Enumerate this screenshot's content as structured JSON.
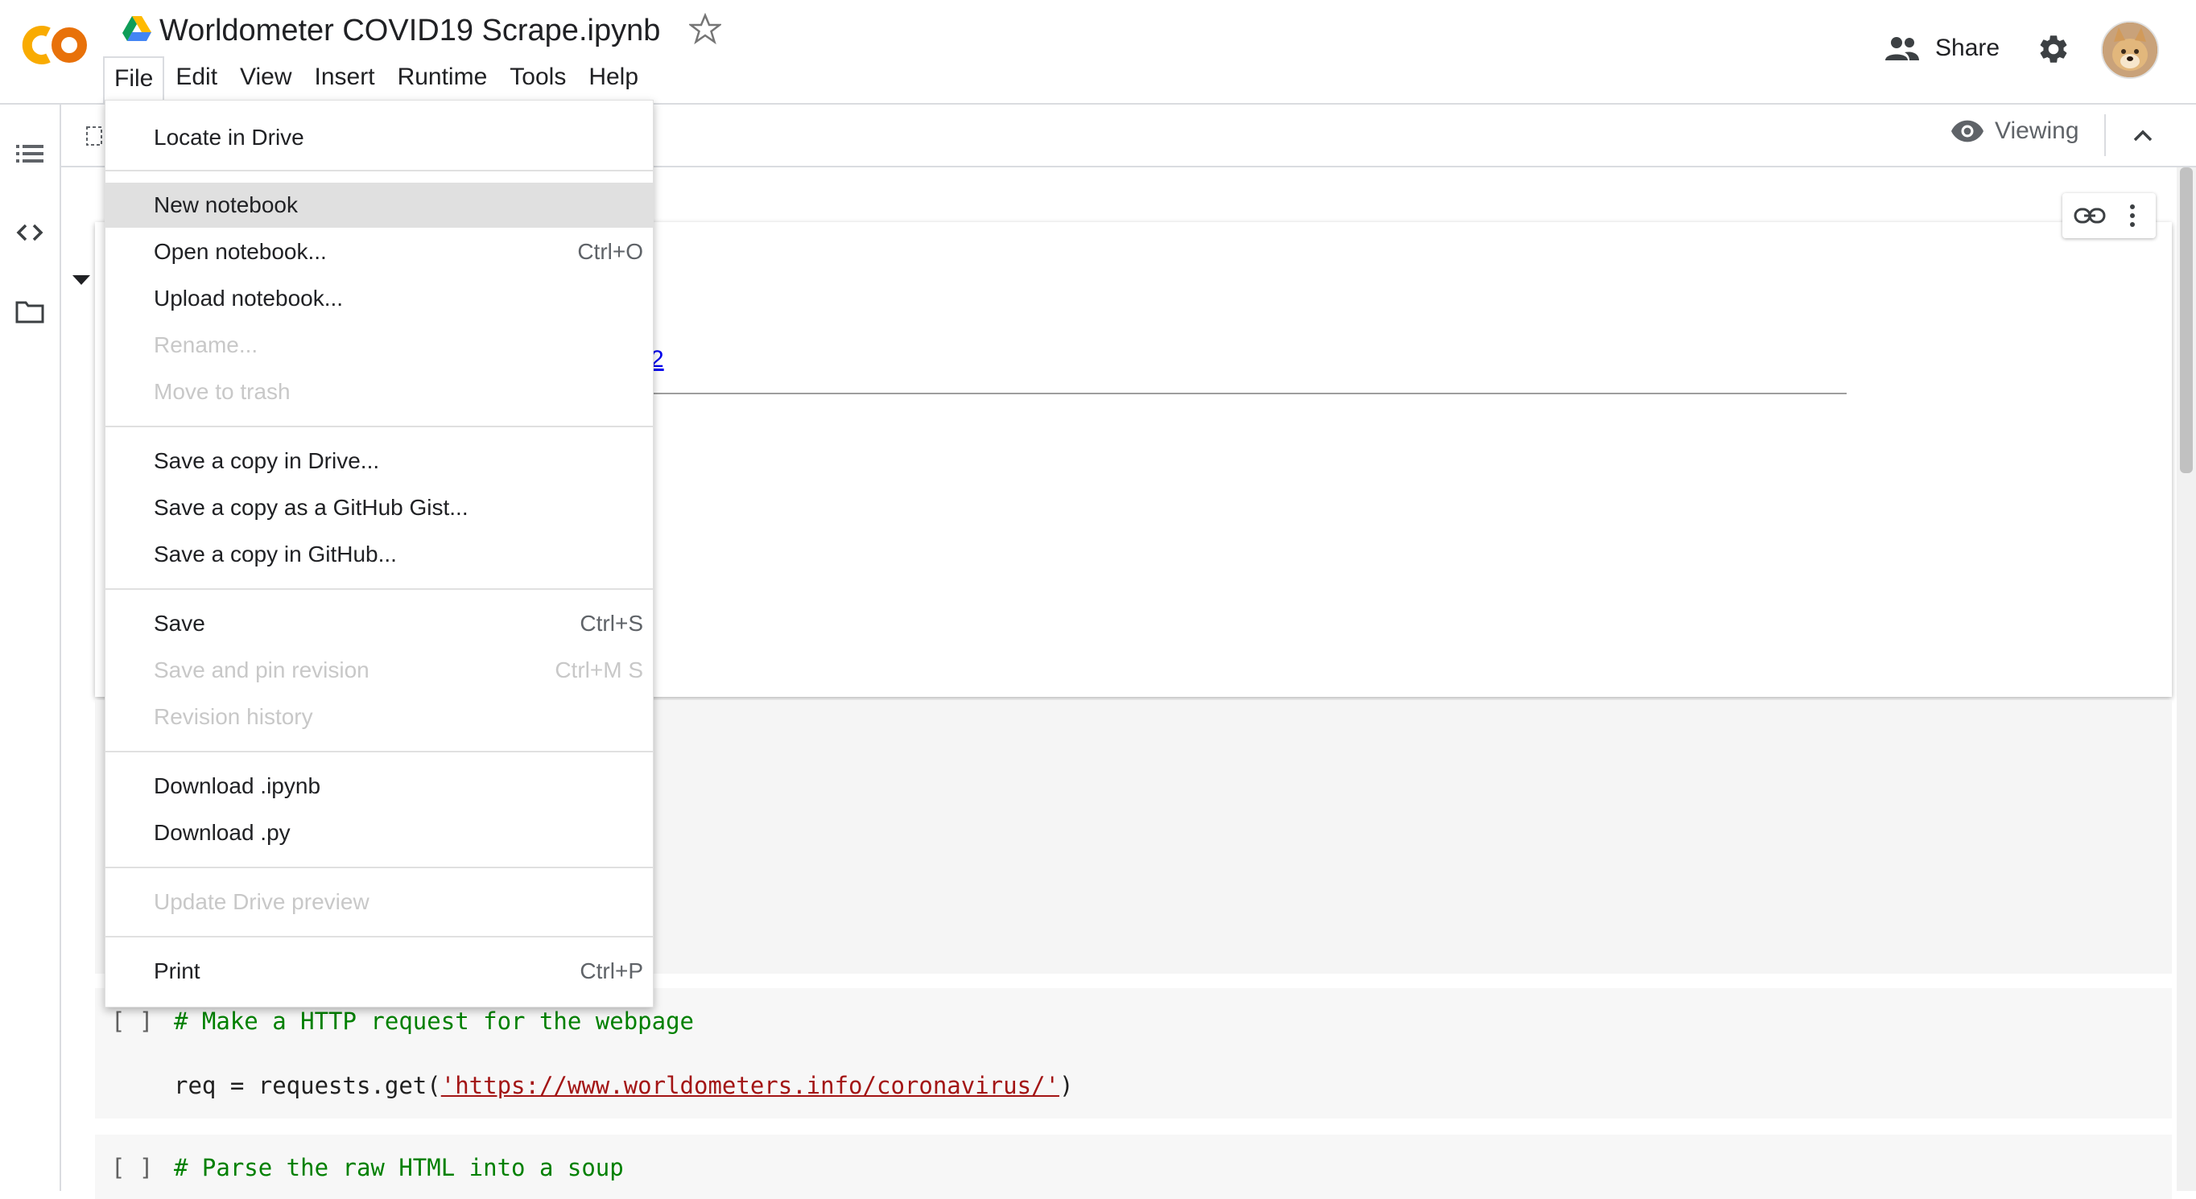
{
  "app": {
    "title": "Worldometer COVID19 Scrape.ipynb",
    "logo_text": "CO"
  },
  "menu": {
    "file": "File",
    "edit": "Edit",
    "view": "View",
    "insert": "Insert",
    "runtime": "Runtime",
    "tools": "Tools",
    "help": "Help"
  },
  "header": {
    "share_label": "Share"
  },
  "toolbar": {
    "viewing_label": "Viewing"
  },
  "file_menu": {
    "locate_in_drive": "Locate in Drive",
    "new_notebook": "New notebook",
    "open_notebook": "Open notebook...",
    "open_notebook_shortcut": "Ctrl+O",
    "upload_notebook": "Upload notebook...",
    "rename": "Rename...",
    "move_to_trash": "Move to trash",
    "save_copy_drive": "Save a copy in Drive...",
    "save_copy_gist": "Save a copy as a GitHub Gist...",
    "save_copy_github": "Save a copy in GitHub...",
    "save": "Save",
    "save_shortcut": "Ctrl+S",
    "save_pin_revision": "Save and pin revision",
    "save_pin_shortcut": "Ctrl+M S",
    "revision_history": "Revision history",
    "download_ipynb": "Download .ipynb",
    "download_py": "Download .py",
    "update_drive_preview": "Update Drive preview",
    "print": "Print",
    "print_shortcut": "Ctrl+P"
  },
  "notebook": {
    "link_fragment": "2",
    "cell1": {
      "run_bracket": "[ ]",
      "comment": "# Make a HTTP request for the webpage",
      "code_prefix": "req = requests.get(",
      "code_string": "'https://www.worldometers.info/coronavirus/'",
      "code_suffix": ")"
    },
    "cell2": {
      "run_bracket": "[ ]",
      "comment": "# Parse the raw HTML into a soup"
    }
  },
  "colors": {
    "logo_orange": "#F9AB00",
    "comment_green": "#008000",
    "string_red": "#A31515",
    "menu_hover": "#E0E0E0",
    "disabled_text": "#C8C8C8"
  },
  "icons": [
    "colab-logo",
    "drive-icon",
    "star-icon",
    "people-icon",
    "gear-icon",
    "avatar",
    "toc-icon",
    "code-snippets-icon",
    "folder-icon",
    "eye-icon",
    "chevron-up-icon",
    "link-icon",
    "kebab-icon"
  ]
}
